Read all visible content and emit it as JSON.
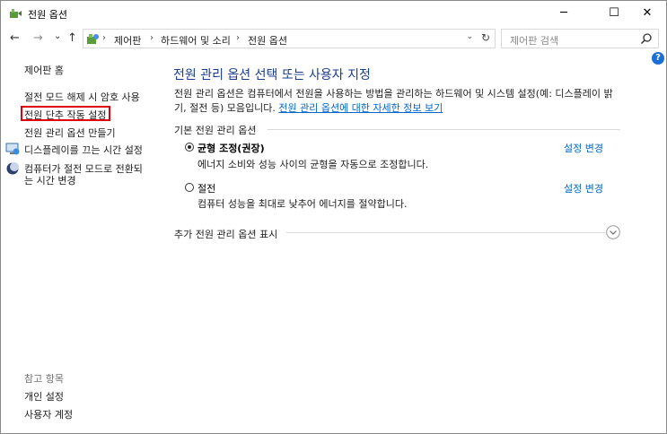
{
  "window": {
    "title": "전원 옵션",
    "minimize": "─",
    "maximize": "☐",
    "close": "✕"
  },
  "nav": {
    "back": "←",
    "forward": "→",
    "recent": "⌄",
    "up": "↑"
  },
  "address": {
    "breadcrumbs": [
      "제어판",
      "하드웨어 및 소리",
      "전원 옵션"
    ],
    "separator": "›",
    "dropdown": "⌄",
    "refresh": "↻"
  },
  "search": {
    "placeholder": "제어판 검색"
  },
  "help": "?",
  "sidebar": {
    "home": "제어판 홈",
    "links": [
      {
        "label": "절전 모드 해제 시 암호 사용"
      },
      {
        "label": "전원 단추 작동 설정"
      },
      {
        "label": "전원 관리 옵션 만들기"
      },
      {
        "label": "디스플레이를 끄는 시간 설정"
      },
      {
        "label": "컴퓨터가 절전 모드로 전환되",
        "label2": "는 시간 변경"
      }
    ],
    "see_also": "참고 항목",
    "see_also_links": [
      "개인 설정",
      "사용자 계정"
    ]
  },
  "main": {
    "title": "전원 관리 옵션 선택 또는 사용자 지정",
    "description_line1": "전원 관리 옵션은 컴퓨터에서 전원을 사용하는 방법을 관리하는 하드웨어 및 시스템 설정(예: 디스플레이 밝",
    "description_line2": "기, 절전 등) 모음입니다.",
    "description_link": "전원 관리 옵션에 대한 자세한 정보 보기",
    "group_label": "기본 전원 관리 옵션",
    "plans": [
      {
        "name": "균형 조정(권장)",
        "description": "에너지 소비와 성능 사이의 균형을 자동으로 조정합니다.",
        "change": "설정 변경",
        "selected": true
      },
      {
        "name": "절전",
        "description": "컴퓨터 성능을 최대로 낮추어 에너지를 절약합니다.",
        "change": "설정 변경",
        "selected": false
      }
    ],
    "more_plans": "추가 전원 관리 옵션 표시"
  },
  "colors": {
    "title_blue": "#1a3c8f",
    "link_blue": "#0066cc",
    "highlight_red": "#e0000b"
  }
}
